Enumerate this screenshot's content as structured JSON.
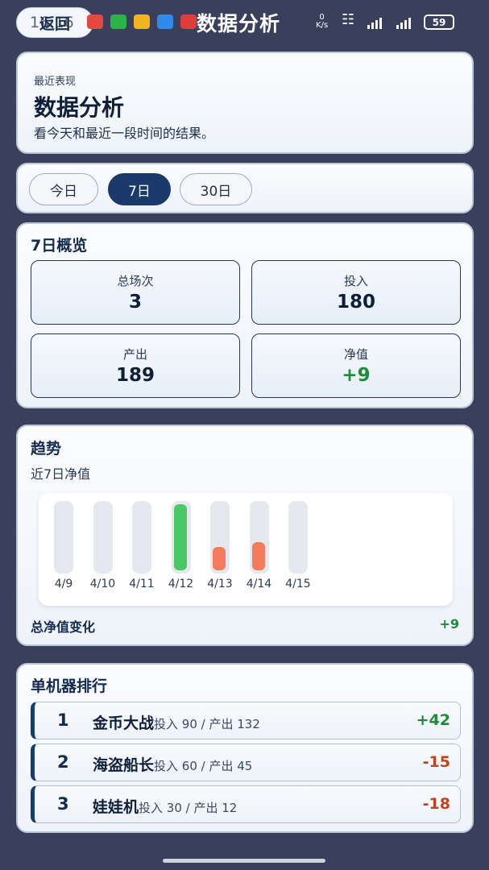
{
  "status_bar": {
    "time": "16:16",
    "net_speed_value": "0",
    "net_speed_unit": "K/s",
    "battery": "59"
  },
  "top_bar": {
    "back_label": "返回",
    "title": "数据分析"
  },
  "header": {
    "kicker": "最近表现",
    "title": "数据分析",
    "subtitle": "看今天和最近一段时间的结果。"
  },
  "tabs": [
    {
      "label": "今日",
      "selected": false
    },
    {
      "label": "7日",
      "selected": true
    },
    {
      "label": "30日",
      "selected": false
    }
  ],
  "overview": {
    "title": "7日概览",
    "stats": [
      {
        "label": "总场次",
        "value": "3"
      },
      {
        "label": "投入",
        "value": "180"
      },
      {
        "label": "产出",
        "value": "189"
      },
      {
        "label": "净值",
        "value": "+9"
      }
    ]
  },
  "trend": {
    "title": "趋势",
    "subtitle": "近7日净值",
    "total_label": "总净值变化",
    "total_value": "+9",
    "colors": {
      "positive": "#4cc765",
      "negative": "#f47c5d",
      "track": "#e5e8ee"
    }
  },
  "chart_data": {
    "type": "bar",
    "categories": [
      "4/9",
      "4/10",
      "4/11",
      "4/12",
      "4/13",
      "4/14",
      "4/15"
    ],
    "values": [
      0,
      0,
      0,
      42,
      -15,
      -18,
      0
    ],
    "ylim": [
      -42,
      42
    ]
  },
  "ranking": {
    "title": "单机器排行",
    "rows": [
      {
        "rank": "1",
        "name": "金币大战",
        "detail": "投入 90 / 产出 132",
        "delta": "+42"
      },
      {
        "rank": "2",
        "name": "海盗船长",
        "detail": "投入 60 / 产出 45",
        "delta": "-15"
      },
      {
        "rank": "3",
        "name": "娃娃机",
        "detail": "投入 30 / 产出 12",
        "delta": "-18"
      }
    ]
  }
}
